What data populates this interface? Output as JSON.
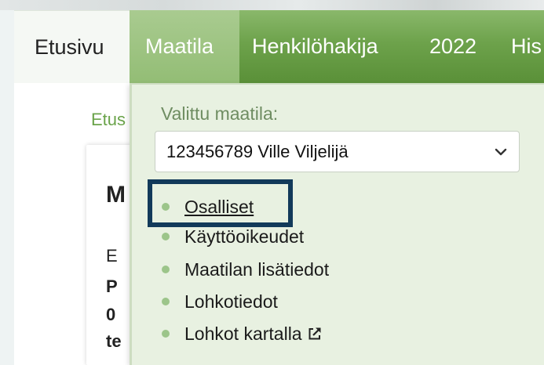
{
  "nav": {
    "items": [
      {
        "label": "Etusivu"
      },
      {
        "label": "Maatila"
      },
      {
        "label": "Henkilöhakija"
      },
      {
        "label": "2022"
      },
      {
        "label": "His"
      }
    ]
  },
  "page": {
    "breadcrumb": "Etus",
    "card": {
      "title": "M",
      "lines": [
        "E",
        "P",
        "0",
        "te"
      ]
    }
  },
  "dropdown": {
    "label": "Valittu maatila:",
    "select_value": "123456789 Ville Viljelijä",
    "items": [
      {
        "label": "Osalliset"
      },
      {
        "label": "Käyttöoikeudet"
      },
      {
        "label": "Maatilan lisätiedot"
      },
      {
        "label": "Lohkotiedot"
      },
      {
        "label": "Lohkot kartalla"
      }
    ]
  },
  "colors": {
    "nav_green": "#6da24b",
    "active_tab": "#93bd75",
    "dropdown_bg": "#e8f1e1",
    "bullet": "#9cc58a",
    "highlight_border": "#123a5a",
    "breadcrumb_green": "#6aa34a"
  }
}
